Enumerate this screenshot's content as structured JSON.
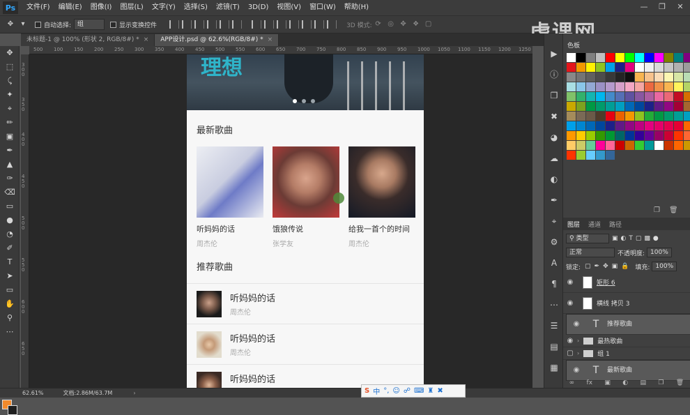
{
  "app": {
    "logo": "Ps"
  },
  "menu": [
    "文件(F)",
    "编辑(E)",
    "图像(I)",
    "图层(L)",
    "文字(Y)",
    "选择(S)",
    "滤镜(T)",
    "3D(D)",
    "视图(V)",
    "窗口(W)",
    "帮助(H)"
  ],
  "options": {
    "auto_select_label": "自动选择:",
    "auto_select_value": "组",
    "transform_label": "显示变换控件",
    "mode_3d_label": "3D 模式:"
  },
  "tabs": [
    {
      "label": "未标题-1 @ 100% (形状 2, RGB/8#) *",
      "active": false
    },
    {
      "label": "APP设计.psd @ 62.6%(RGB/8#) *",
      "active": true
    }
  ],
  "ruler": {
    "h_ticks": [
      "500",
      "100",
      "150",
      "200",
      "250",
      "300",
      "350",
      "400",
      "450",
      "500",
      "550",
      "600",
      "650",
      "700",
      "750",
      "800",
      "850",
      "900",
      "950",
      "1000",
      "1050",
      "1100",
      "1150",
      "1200",
      "1250"
    ]
  },
  "document": {
    "banner_title": "理想",
    "section_new": "最新歌曲",
    "albums": [
      {
        "title": "听妈妈的话",
        "artist": "周杰伦"
      },
      {
        "title": "饿狼传说",
        "artist": "张学友"
      },
      {
        "title": "给我一首个的时间",
        "artist": "周杰伦"
      }
    ],
    "section_recommend": "推荐歌曲",
    "recommend": [
      {
        "title": "听妈妈的话",
        "artist": "周杰伦"
      },
      {
        "title": "听妈妈的话",
        "artist": "周杰伦"
      },
      {
        "title": "听妈妈的话",
        "artist": ""
      }
    ]
  },
  "status": {
    "zoom": "62.61%",
    "doc": "文档:2.86M/63.7M"
  },
  "ime": {
    "label": "中"
  },
  "watermark": "虎课网",
  "swatches": {
    "title": "色板",
    "colors": [
      "#ffffff",
      "#000000",
      "#808080",
      "#c0c0c0",
      "#ff0000",
      "#ffff00",
      "#00ff00",
      "#00ffff",
      "#0000ff",
      "#ff00ff",
      "#808000",
      "#008080",
      "#800080",
      "#e4151b",
      "#f39800",
      "#fff100",
      "#8fc31f",
      "#00a0e9",
      "#1d2088",
      "#e4007f",
      "#ffffff",
      "#f0f0f0",
      "#d9d9d9",
      "#c4c4c4",
      "#b0b0b0",
      "#9c9c9c",
      "#888888",
      "#747474",
      "#606060",
      "#4c4c4c",
      "#383838",
      "#242424",
      "#101010",
      "#f8b551",
      "#f7c28c",
      "#fadbb6",
      "#fcf6b2",
      "#d7e6a5",
      "#b9dcb4",
      "#a9dfe4",
      "#8ac6e8",
      "#93a9d4",
      "#9b91c5",
      "#b59acc",
      "#d6a0c9",
      "#f3a7c4",
      "#f5a6a4",
      "#ec6941",
      "#f19149",
      "#f8b551",
      "#fff45c",
      "#b3d465",
      "#80c269",
      "#32b16c",
      "#13b5b1",
      "#00b7ee",
      "#448aca",
      "#556fb5",
      "#5f52a0",
      "#8957a1",
      "#ae5da1",
      "#ea68a2",
      "#eb6877",
      "#c30d23",
      "#d66f00",
      "#c9a900",
      "#7ca21f",
      "#009944",
      "#009b6b",
      "#009e96",
      "#00a0c1",
      "#0068b7",
      "#00479d",
      "#1d2088",
      "#601986",
      "#920783",
      "#a40035",
      "#a5672f",
      "#a58c5b",
      "#7a6a56",
      "#6b5a48",
      "#4f3b2a",
      "#e60012",
      "#eb6100",
      "#f39800",
      "#8fc31f",
      "#22ac38",
      "#009944",
      "#009b6b",
      "#009e96",
      "#00a0c1",
      "#00a0e9",
      "#0086d1",
      "#0068b7",
      "#00479d",
      "#1d2088",
      "#601986",
      "#920783",
      "#be0081",
      "#e4007f",
      "#e5006a",
      "#e5004f",
      "#e60033",
      "#ff6600",
      "#ff9900",
      "#ffcc00",
      "#99cc00",
      "#339900",
      "#009933",
      "#006666",
      "#003399",
      "#330099",
      "#660099",
      "#990066",
      "#cc0033",
      "#ff3300",
      "#ff6633",
      "#ffcc66",
      "#cccc66",
      "#66cc99",
      "#ff0099",
      "#ff6699",
      "#cc0000",
      "#cc6600",
      "#33cc33",
      "#009999",
      "#ffffff",
      "#cc3300",
      "#ff6600",
      "#cc9900",
      "#ff3300",
      "#99cc33",
      "#66ccff",
      "#3399cc",
      "#336699"
    ]
  },
  "layers": {
    "tabs": [
      "图层",
      "通道",
      "路径"
    ],
    "filter": "类型",
    "blend": "正常",
    "opacity_label": "不透明度:",
    "opacity": "100%",
    "lock_label": "锁定:",
    "fill_label": "填充:",
    "fill": "100%",
    "items": [
      {
        "name": "矩形 6",
        "kind": "shape",
        "selected": false
      },
      {
        "name": "横线 拷贝 3",
        "kind": "shape",
        "selected": false
      },
      {
        "name": "推荐歌曲",
        "kind": "text",
        "selected": true
      },
      {
        "name": "最热歌曲",
        "kind": "group",
        "selected": false
      },
      {
        "name": "组 1",
        "kind": "group",
        "selected": false
      },
      {
        "name": "最新歌曲",
        "kind": "text",
        "selected": true
      }
    ]
  }
}
